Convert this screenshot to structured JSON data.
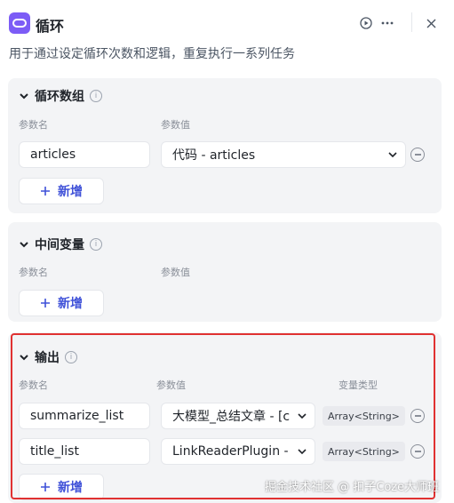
{
  "header": {
    "title": "循环",
    "description": "用于通过设定循环次数和逻辑，重复执行一系列任务",
    "icons": [
      "loop-icon",
      "play-circle-icon",
      "more-icon",
      "close-icon"
    ]
  },
  "sections": {
    "loop_array": {
      "title": "循环数组",
      "col_name": "参数名",
      "col_value": "参数值",
      "rows": [
        {
          "name": "articles",
          "value": "代码 - articles"
        }
      ],
      "add_label": "新增"
    },
    "intermediate": {
      "title": "中间变量",
      "col_name": "参数名",
      "col_value": "参数值",
      "add_label": "新增"
    },
    "output": {
      "title": "输出",
      "col_name": "参数名",
      "col_value": "参数值",
      "col_type": "变量类型",
      "rows": [
        {
          "name": "summarize_list",
          "value": "大模型_总结文章 - [c",
          "type": "Array<String>"
        },
        {
          "name": "title_list",
          "value": "LinkReaderPlugin -",
          "type": "Array<String>"
        }
      ],
      "add_label": "新增"
    }
  },
  "watermark": "掘金技术社区 @ 扣子Coze大师班",
  "colors": {
    "accent": "#3f51d8",
    "logo": "#7c5cf6",
    "highlight_border": "#e03131",
    "panel_bg": "#f3f4f6"
  }
}
